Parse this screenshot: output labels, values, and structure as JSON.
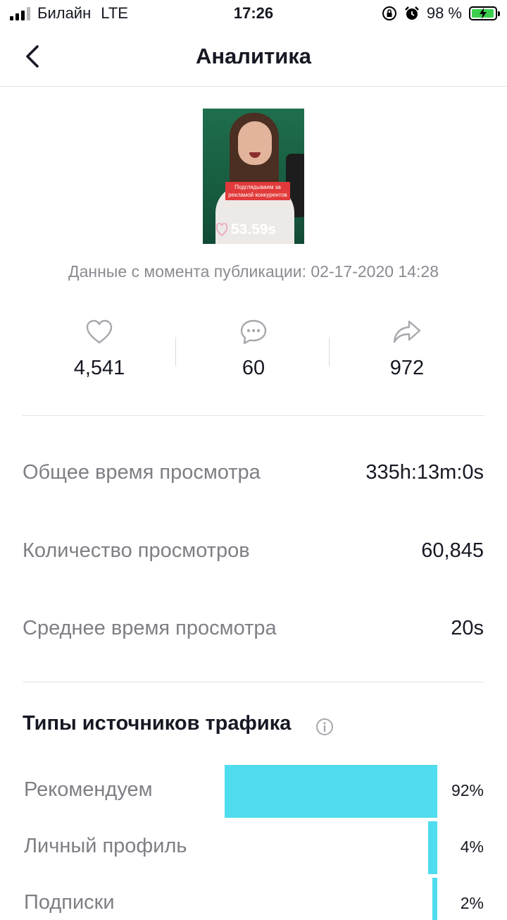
{
  "status_bar": {
    "carrier": "Билайн",
    "network": "LTE",
    "time": "17:26",
    "battery": "98 %",
    "battery_level": 0.98
  },
  "header": {
    "title": "Аналитика",
    "back_icon": "chevron-left-icon"
  },
  "video": {
    "caption": "Подглядываем за рекламой конкурентов",
    "duration": "53.59s"
  },
  "published": "Данные с момента публикации: 02-17-2020 14:28",
  "engagement": {
    "likes": "4,541",
    "comments": "60",
    "shares": "972"
  },
  "metrics": {
    "total_watch_label": "Общее время просмотра",
    "total_watch_value": "335h:13m:0s",
    "views_label": "Количество просмотров",
    "views_value": "60,845",
    "avg_watch_label": "Среднее время просмотра",
    "avg_watch_value": "20s"
  },
  "traffic": {
    "title": "Типы источников трафика",
    "accent_color": "#4fdcee",
    "sources": [
      {
        "label": "Рекомендуем",
        "percent": "92%",
        "value": 92
      },
      {
        "label": "Личный профиль",
        "percent": "4%",
        "value": 4
      },
      {
        "label": "Подписки",
        "percent": "2%",
        "value": 2
      }
    ]
  }
}
